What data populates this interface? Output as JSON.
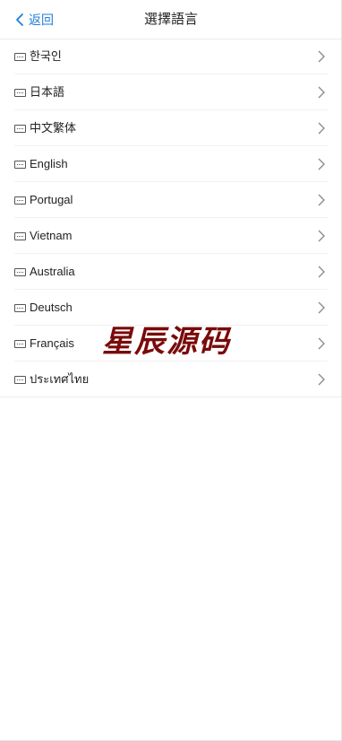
{
  "header": {
    "back_label": "返回",
    "title": "選擇語言"
  },
  "languages": [
    {
      "label": "한국인"
    },
    {
      "label": "日本語"
    },
    {
      "label": "中文繁体"
    },
    {
      "label": "English"
    },
    {
      "label": "Portugal"
    },
    {
      "label": "Vietnam"
    },
    {
      "label": "Australia"
    },
    {
      "label": "Deutsch"
    },
    {
      "label": "Français"
    },
    {
      "label": "ประเทศไทย"
    }
  ],
  "watermark": "星辰源码",
  "colors": {
    "accent": "#1e7fd8",
    "watermark": "#7a0a0a"
  },
  "icons": {
    "back": "chevron-left-icon",
    "item_flag": "flag-placeholder-icon",
    "item_arrow": "chevron-right-icon"
  }
}
